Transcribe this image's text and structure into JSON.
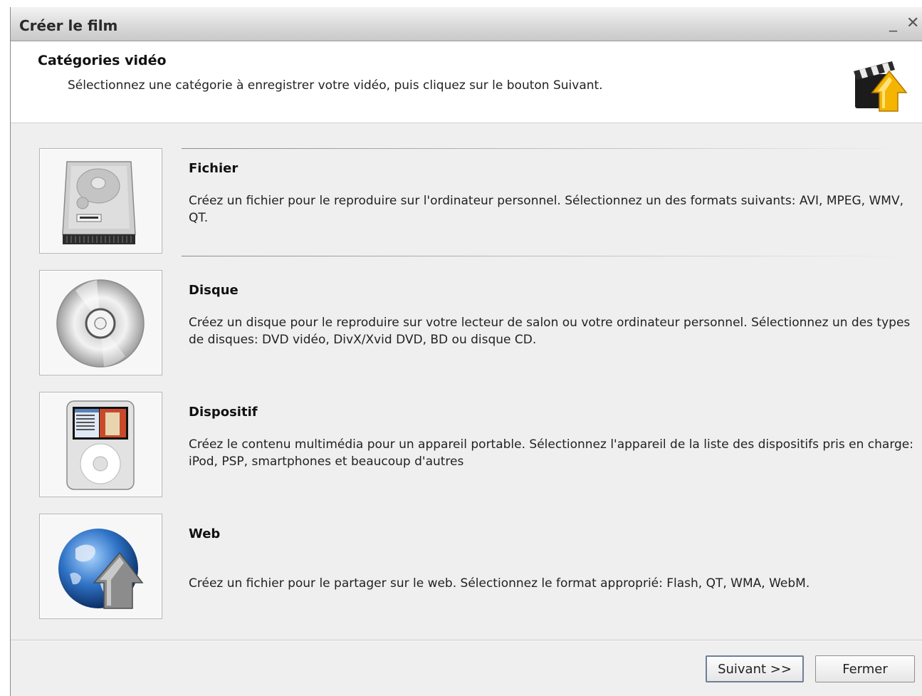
{
  "window": {
    "title": "Créer le film",
    "minimize_glyph": "_",
    "close_glyph": "✕"
  },
  "header": {
    "title": "Catégories vidéo",
    "subtitle": "Sélectionnez une catégorie à enregistrer votre vidéo, puis cliquez sur le bouton Suivant.",
    "icon": "clapperboard-arrow-icon"
  },
  "categories": [
    {
      "name": "Fichier",
      "icon": "hard-drive-icon",
      "description": "Créez un fichier pour le reproduire sur l'ordinateur personnel. Sélectionnez un des formats suivants: AVI, MPEG, WMV, QT."
    },
    {
      "name": "Disque",
      "icon": "disc-icon",
      "description": "Créez un disque pour le reproduire sur votre lecteur de salon ou votre ordinateur personnel. Sélectionnez un des types de disques: DVD vidéo, DivX/Xvid DVD, BD ou disque CD."
    },
    {
      "name": "Dispositif",
      "icon": "ipod-icon",
      "description": "Créez le contenu multimédia pour un appareil portable. Sélectionnez l'appareil de la liste des dispositifs pris en charge: iPod, PSP, smartphones et beaucoup d'autres"
    },
    {
      "name": "Web",
      "icon": "globe-arrow-icon",
      "description": "Créez un fichier pour le partager sur le web. Sélectionnez le format approprié: Flash, QT, WMA, WebM."
    }
  ],
  "buttons": {
    "next_label": "Suivant >>",
    "close_label": "Fermer"
  }
}
